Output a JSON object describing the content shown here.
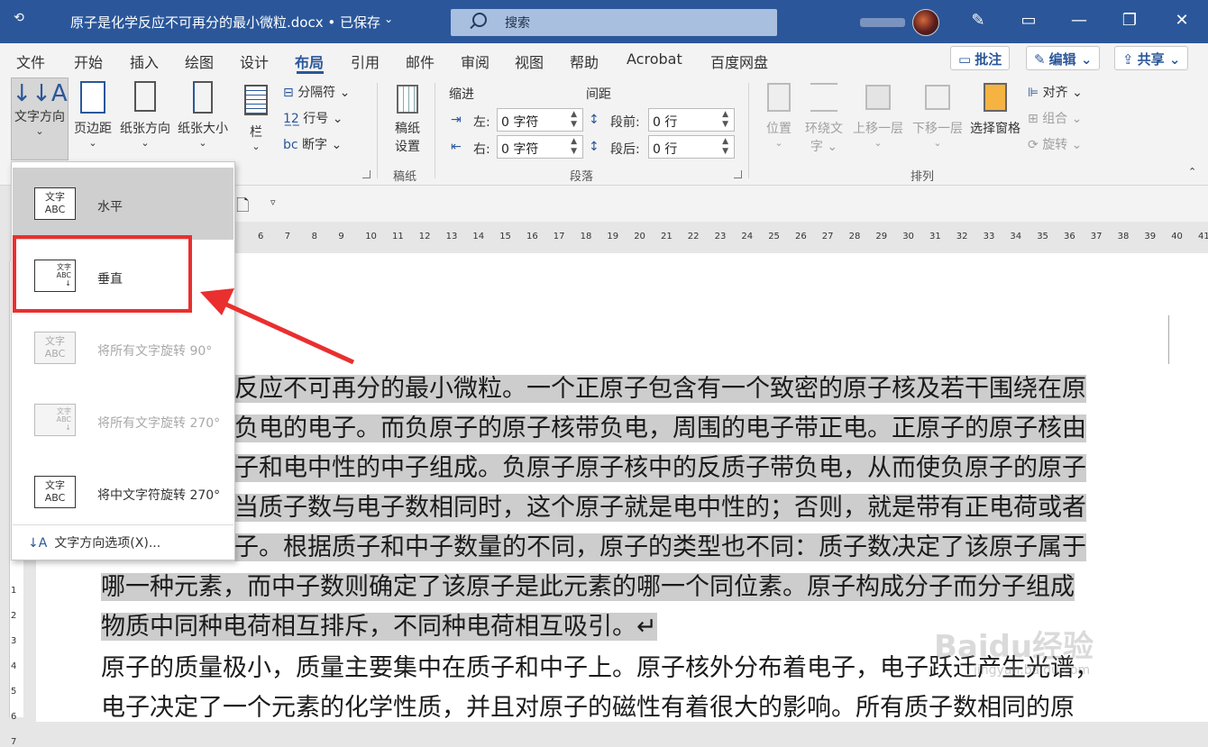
{
  "titlebar": {
    "doc_title": "原子是化学反应不可再分的最小微粒.docx",
    "saved_status": "• 已保存",
    "search_placeholder": "搜索"
  },
  "tabs": [
    "文件",
    "开始",
    "插入",
    "绘图",
    "设计",
    "布局",
    "引用",
    "邮件",
    "审阅",
    "视图",
    "帮助",
    "Acrobat",
    "百度网盘"
  ],
  "active_tab": "布局",
  "header_buttons": {
    "comments": "批注",
    "editing": "编辑",
    "share": "共享"
  },
  "ribbon": {
    "page_setup": {
      "text_direction": "文字方向",
      "margins": "页边距",
      "orientation": "纸张方向",
      "size": "纸张大小",
      "columns": "栏",
      "breaks": "分隔符",
      "line_numbers": "行号",
      "hyphenation": "断字"
    },
    "manuscript": {
      "button_line1": "稿纸",
      "button_line2": "设置",
      "group_label": "稿纸"
    },
    "paragraph": {
      "indent_header": "缩进",
      "spacing_header": "间距",
      "left_label": "左:",
      "right_label": "右:",
      "before_label": "段前:",
      "after_label": "段后:",
      "left_value": "0 字符",
      "right_value": "0 字符",
      "before_value": "0 行",
      "after_value": "0 行",
      "group_label": "段落"
    },
    "arrange": {
      "position": "位置",
      "wrap_text_line1": "环绕文",
      "wrap_text_line2": "字",
      "bring_forward": "上移一层",
      "send_backward": "下移一层",
      "selection_pane": "选择窗格",
      "align": "对齐",
      "group": "组合",
      "rotate": "旋转",
      "group_label": "排列"
    }
  },
  "ruler_numbers": [
    "6",
    "7",
    "8",
    "9",
    "10",
    "11",
    "12",
    "13",
    "14",
    "15",
    "16",
    "17",
    "18",
    "19",
    "20",
    "21",
    "22",
    "23",
    "24",
    "25",
    "26",
    "27",
    "28",
    "29",
    "30",
    "31",
    "32",
    "33",
    "34",
    "35",
    "36",
    "37",
    "38",
    "39",
    "40",
    "41"
  ],
  "vruler_numbers": [
    "1",
    "2",
    "3",
    "4",
    "5",
    "6",
    "7"
  ],
  "popup": {
    "items": [
      {
        "icon_text": "文字\nABC",
        "label": "水平",
        "enabled": true,
        "selected": true
      },
      {
        "icon_text": "文字\nABC",
        "label": "垂直",
        "enabled": true,
        "selected": false
      },
      {
        "icon_text": "文字\nABC",
        "label": "将所有文字旋转 90°",
        "enabled": false,
        "selected": false
      },
      {
        "icon_text": "文字\nABC",
        "label": "将所有文字旋转 270°",
        "enabled": false,
        "selected": false
      },
      {
        "icon_text": "文字\nABC",
        "label": "将中文字符旋转 270°",
        "enabled": true,
        "selected": false
      }
    ],
    "options_label": "文字方向选项(X)..."
  },
  "document": {
    "lines": [
      {
        "text": "反应不可再分的最小微粒。一个正原子包含有一个致密的原子核及若干围绕在原",
        "highlight": true
      },
      {
        "text": "负电的电子。而负原子的原子核带负电，周围的电子带正电。正原子的原子核由",
        "highlight": true
      },
      {
        "text": "子和电中性的中子组成。负原子原子核中的反质子带负电，从而使负原子的原子",
        "highlight": true
      },
      {
        "text": "当质子数与电子数相同时，这个原子就是电中性的；否则，就是带有正电荷或者",
        "highlight": true
      },
      {
        "text": "子。根据质子和中子数量的不同，原子的类型也不同：质子数决定了该原子属于",
        "highlight": true
      },
      {
        "text": "哪一种元素，而中子数则确定了该原子是此元素的哪一个同位素。原子构成分子而分子组成",
        "highlight": true
      },
      {
        "text": "物质中同种电荷相互排斥，不同种电荷相互吸引。↵",
        "highlight": true
      },
      {
        "text": "原子的质量极小，质量主要集中在质子和中子上。原子核外分布着电子，电子跃迁产生光谱，",
        "highlight": false
      },
      {
        "text": "电子决定了一个元素的化学性质，并且对原子的磁性有着很大的影响。所有质子数相同的原",
        "highlight": false
      }
    ]
  },
  "watermark": {
    "main": "Baidu经验",
    "sub": "jingyan.baidu.com"
  },
  "colors": {
    "title_blue": "#2b579a",
    "highlight_gray": "#cdcdcd",
    "annotation_red": "#ea2f2f"
  }
}
